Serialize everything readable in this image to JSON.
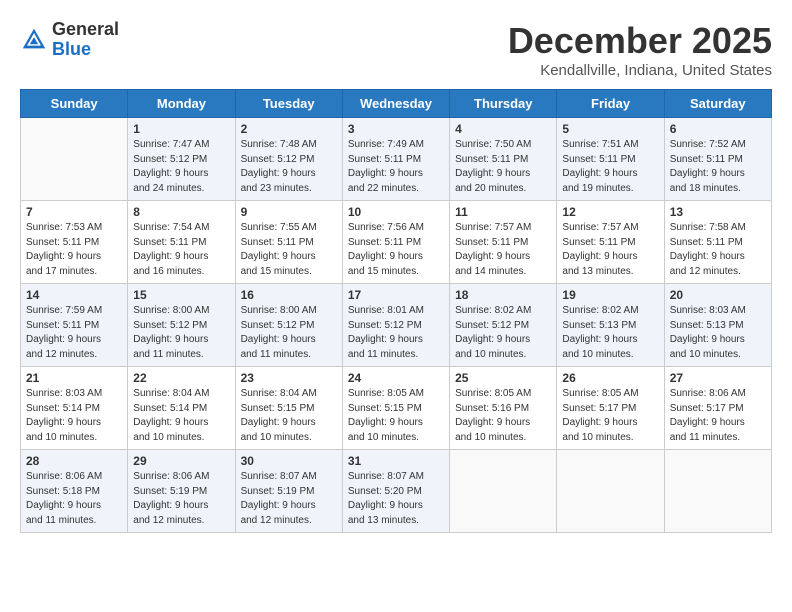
{
  "header": {
    "logo_general": "General",
    "logo_blue": "Blue",
    "month": "December 2025",
    "location": "Kendallville, Indiana, United States"
  },
  "weekdays": [
    "Sunday",
    "Monday",
    "Tuesday",
    "Wednesday",
    "Thursday",
    "Friday",
    "Saturday"
  ],
  "weeks": [
    [
      {
        "day": "",
        "info": ""
      },
      {
        "day": "1",
        "info": "Sunrise: 7:47 AM\nSunset: 5:12 PM\nDaylight: 9 hours\nand 24 minutes."
      },
      {
        "day": "2",
        "info": "Sunrise: 7:48 AM\nSunset: 5:12 PM\nDaylight: 9 hours\nand 23 minutes."
      },
      {
        "day": "3",
        "info": "Sunrise: 7:49 AM\nSunset: 5:11 PM\nDaylight: 9 hours\nand 22 minutes."
      },
      {
        "day": "4",
        "info": "Sunrise: 7:50 AM\nSunset: 5:11 PM\nDaylight: 9 hours\nand 20 minutes."
      },
      {
        "day": "5",
        "info": "Sunrise: 7:51 AM\nSunset: 5:11 PM\nDaylight: 9 hours\nand 19 minutes."
      },
      {
        "day": "6",
        "info": "Sunrise: 7:52 AM\nSunset: 5:11 PM\nDaylight: 9 hours\nand 18 minutes."
      }
    ],
    [
      {
        "day": "7",
        "info": "Sunrise: 7:53 AM\nSunset: 5:11 PM\nDaylight: 9 hours\nand 17 minutes."
      },
      {
        "day": "8",
        "info": "Sunrise: 7:54 AM\nSunset: 5:11 PM\nDaylight: 9 hours\nand 16 minutes."
      },
      {
        "day": "9",
        "info": "Sunrise: 7:55 AM\nSunset: 5:11 PM\nDaylight: 9 hours\nand 15 minutes."
      },
      {
        "day": "10",
        "info": "Sunrise: 7:56 AM\nSunset: 5:11 PM\nDaylight: 9 hours\nand 15 minutes."
      },
      {
        "day": "11",
        "info": "Sunrise: 7:57 AM\nSunset: 5:11 PM\nDaylight: 9 hours\nand 14 minutes."
      },
      {
        "day": "12",
        "info": "Sunrise: 7:57 AM\nSunset: 5:11 PM\nDaylight: 9 hours\nand 13 minutes."
      },
      {
        "day": "13",
        "info": "Sunrise: 7:58 AM\nSunset: 5:11 PM\nDaylight: 9 hours\nand 12 minutes."
      }
    ],
    [
      {
        "day": "14",
        "info": "Sunrise: 7:59 AM\nSunset: 5:11 PM\nDaylight: 9 hours\nand 12 minutes."
      },
      {
        "day": "15",
        "info": "Sunrise: 8:00 AM\nSunset: 5:12 PM\nDaylight: 9 hours\nand 11 minutes."
      },
      {
        "day": "16",
        "info": "Sunrise: 8:00 AM\nSunset: 5:12 PM\nDaylight: 9 hours\nand 11 minutes."
      },
      {
        "day": "17",
        "info": "Sunrise: 8:01 AM\nSunset: 5:12 PM\nDaylight: 9 hours\nand 11 minutes."
      },
      {
        "day": "18",
        "info": "Sunrise: 8:02 AM\nSunset: 5:12 PM\nDaylight: 9 hours\nand 10 minutes."
      },
      {
        "day": "19",
        "info": "Sunrise: 8:02 AM\nSunset: 5:13 PM\nDaylight: 9 hours\nand 10 minutes."
      },
      {
        "day": "20",
        "info": "Sunrise: 8:03 AM\nSunset: 5:13 PM\nDaylight: 9 hours\nand 10 minutes."
      }
    ],
    [
      {
        "day": "21",
        "info": "Sunrise: 8:03 AM\nSunset: 5:14 PM\nDaylight: 9 hours\nand 10 minutes."
      },
      {
        "day": "22",
        "info": "Sunrise: 8:04 AM\nSunset: 5:14 PM\nDaylight: 9 hours\nand 10 minutes."
      },
      {
        "day": "23",
        "info": "Sunrise: 8:04 AM\nSunset: 5:15 PM\nDaylight: 9 hours\nand 10 minutes."
      },
      {
        "day": "24",
        "info": "Sunrise: 8:05 AM\nSunset: 5:15 PM\nDaylight: 9 hours\nand 10 minutes."
      },
      {
        "day": "25",
        "info": "Sunrise: 8:05 AM\nSunset: 5:16 PM\nDaylight: 9 hours\nand 10 minutes."
      },
      {
        "day": "26",
        "info": "Sunrise: 8:05 AM\nSunset: 5:17 PM\nDaylight: 9 hours\nand 10 minutes."
      },
      {
        "day": "27",
        "info": "Sunrise: 8:06 AM\nSunset: 5:17 PM\nDaylight: 9 hours\nand 11 minutes."
      }
    ],
    [
      {
        "day": "28",
        "info": "Sunrise: 8:06 AM\nSunset: 5:18 PM\nDaylight: 9 hours\nand 11 minutes."
      },
      {
        "day": "29",
        "info": "Sunrise: 8:06 AM\nSunset: 5:19 PM\nDaylight: 9 hours\nand 12 minutes."
      },
      {
        "day": "30",
        "info": "Sunrise: 8:07 AM\nSunset: 5:19 PM\nDaylight: 9 hours\nand 12 minutes."
      },
      {
        "day": "31",
        "info": "Sunrise: 8:07 AM\nSunset: 5:20 PM\nDaylight: 9 hours\nand 13 minutes."
      },
      {
        "day": "",
        "info": ""
      },
      {
        "day": "",
        "info": ""
      },
      {
        "day": "",
        "info": ""
      }
    ]
  ]
}
